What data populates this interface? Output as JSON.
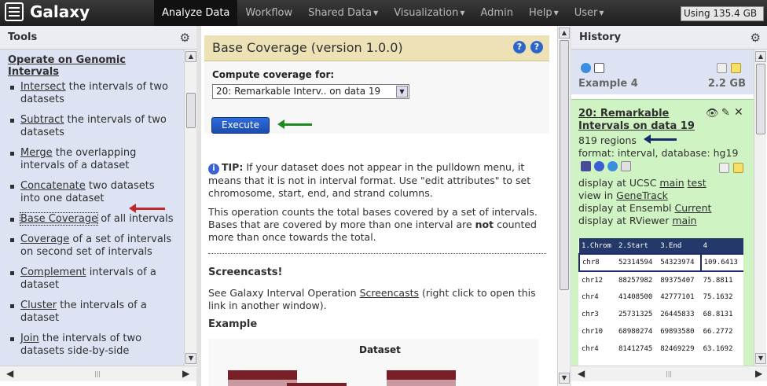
{
  "masthead": {
    "brand": "Galaxy",
    "nav": [
      "Analyze Data",
      "Workflow",
      "Shared Data",
      "Visualization",
      "Admin",
      "Help",
      "User"
    ],
    "quota": "Using 135.4 GB"
  },
  "tools_panel": {
    "title": "Tools",
    "section": "Operate on Genomic Intervals",
    "items": [
      {
        "link": "Intersect",
        "rest": " the intervals of two datasets"
      },
      {
        "link": "Subtract",
        "rest": " the intervals of two datasets"
      },
      {
        "link": "Merge",
        "rest": " the overlapping intervals of a dataset"
      },
      {
        "link": "Concatenate",
        "rest": " two datasets into one dataset"
      },
      {
        "link": "Base Coverage",
        "rest": " of all intervals"
      },
      {
        "link": "Coverage",
        "rest": " of a set of intervals on second set of intervals"
      },
      {
        "link": "Complement",
        "rest": " intervals of a dataset"
      },
      {
        "link": "Cluster",
        "rest": " the intervals of a dataset"
      },
      {
        "link": "Join",
        "rest": " the intervals of two datasets side-by-side"
      }
    ]
  },
  "tool_form": {
    "title": "Base Coverage (version 1.0.0)",
    "field_label": "Compute coverage for:",
    "selected_value": "20: Remarkable Interv.. on data 19",
    "execute_label": "Execute",
    "tip_label": "TIP:",
    "tip_text": " If your dataset does not appear in the pulldown menu, it means that it is not in interval format. Use \"edit attributes\" to set chromosome, start, end, and strand columns.",
    "desc_pre": "This operation counts the total bases covered by a set of intervals. Bases that are covered by more than one interval are ",
    "desc_bold": "not",
    "desc_post": " counted more than once towards the total.",
    "screencasts_heading": "Screencasts!",
    "screencasts_pre": "See Galaxy Interval Operation ",
    "screencasts_link": "Screencasts",
    "screencasts_post": " (right click to open this link in another window).",
    "example_heading": "Example",
    "example_image_title": "Dataset"
  },
  "history_panel": {
    "title": "History",
    "name": "Example 4",
    "size": "2.2 GB",
    "dataset": {
      "title": "20: Remarkable Intervals on data 19",
      "regions": "819 regions",
      "format_line": "format: interval, database: hg19",
      "ucsc_label": "display at UCSC ",
      "ucsc_main": "main",
      "ucsc_test": "test",
      "genetrack_label": "view in ",
      "genetrack_link": "GeneTrack",
      "ensembl_label": "display at Ensembl ",
      "ensembl_link": "Current",
      "rviewer_label": "display at RViewer ",
      "rviewer_link": "main",
      "peek_columns": [
        "1.Chrom",
        "2.Start",
        "3.End",
        "4"
      ],
      "peek_rows": [
        [
          "chr8",
          "52314594",
          "54323974",
          "109.6413"
        ],
        [
          "chr12",
          "88257982",
          "89375407",
          "75.8811"
        ],
        [
          "chr4",
          "41408500",
          "42777101",
          "75.1632"
        ],
        [
          "chr3",
          "25731325",
          "26445833",
          "68.8131"
        ],
        [
          "chr10",
          "68980274",
          "69893580",
          "66.2772"
        ],
        [
          "chr4",
          "81412745",
          "82469229",
          "63.1692"
        ]
      ]
    }
  }
}
